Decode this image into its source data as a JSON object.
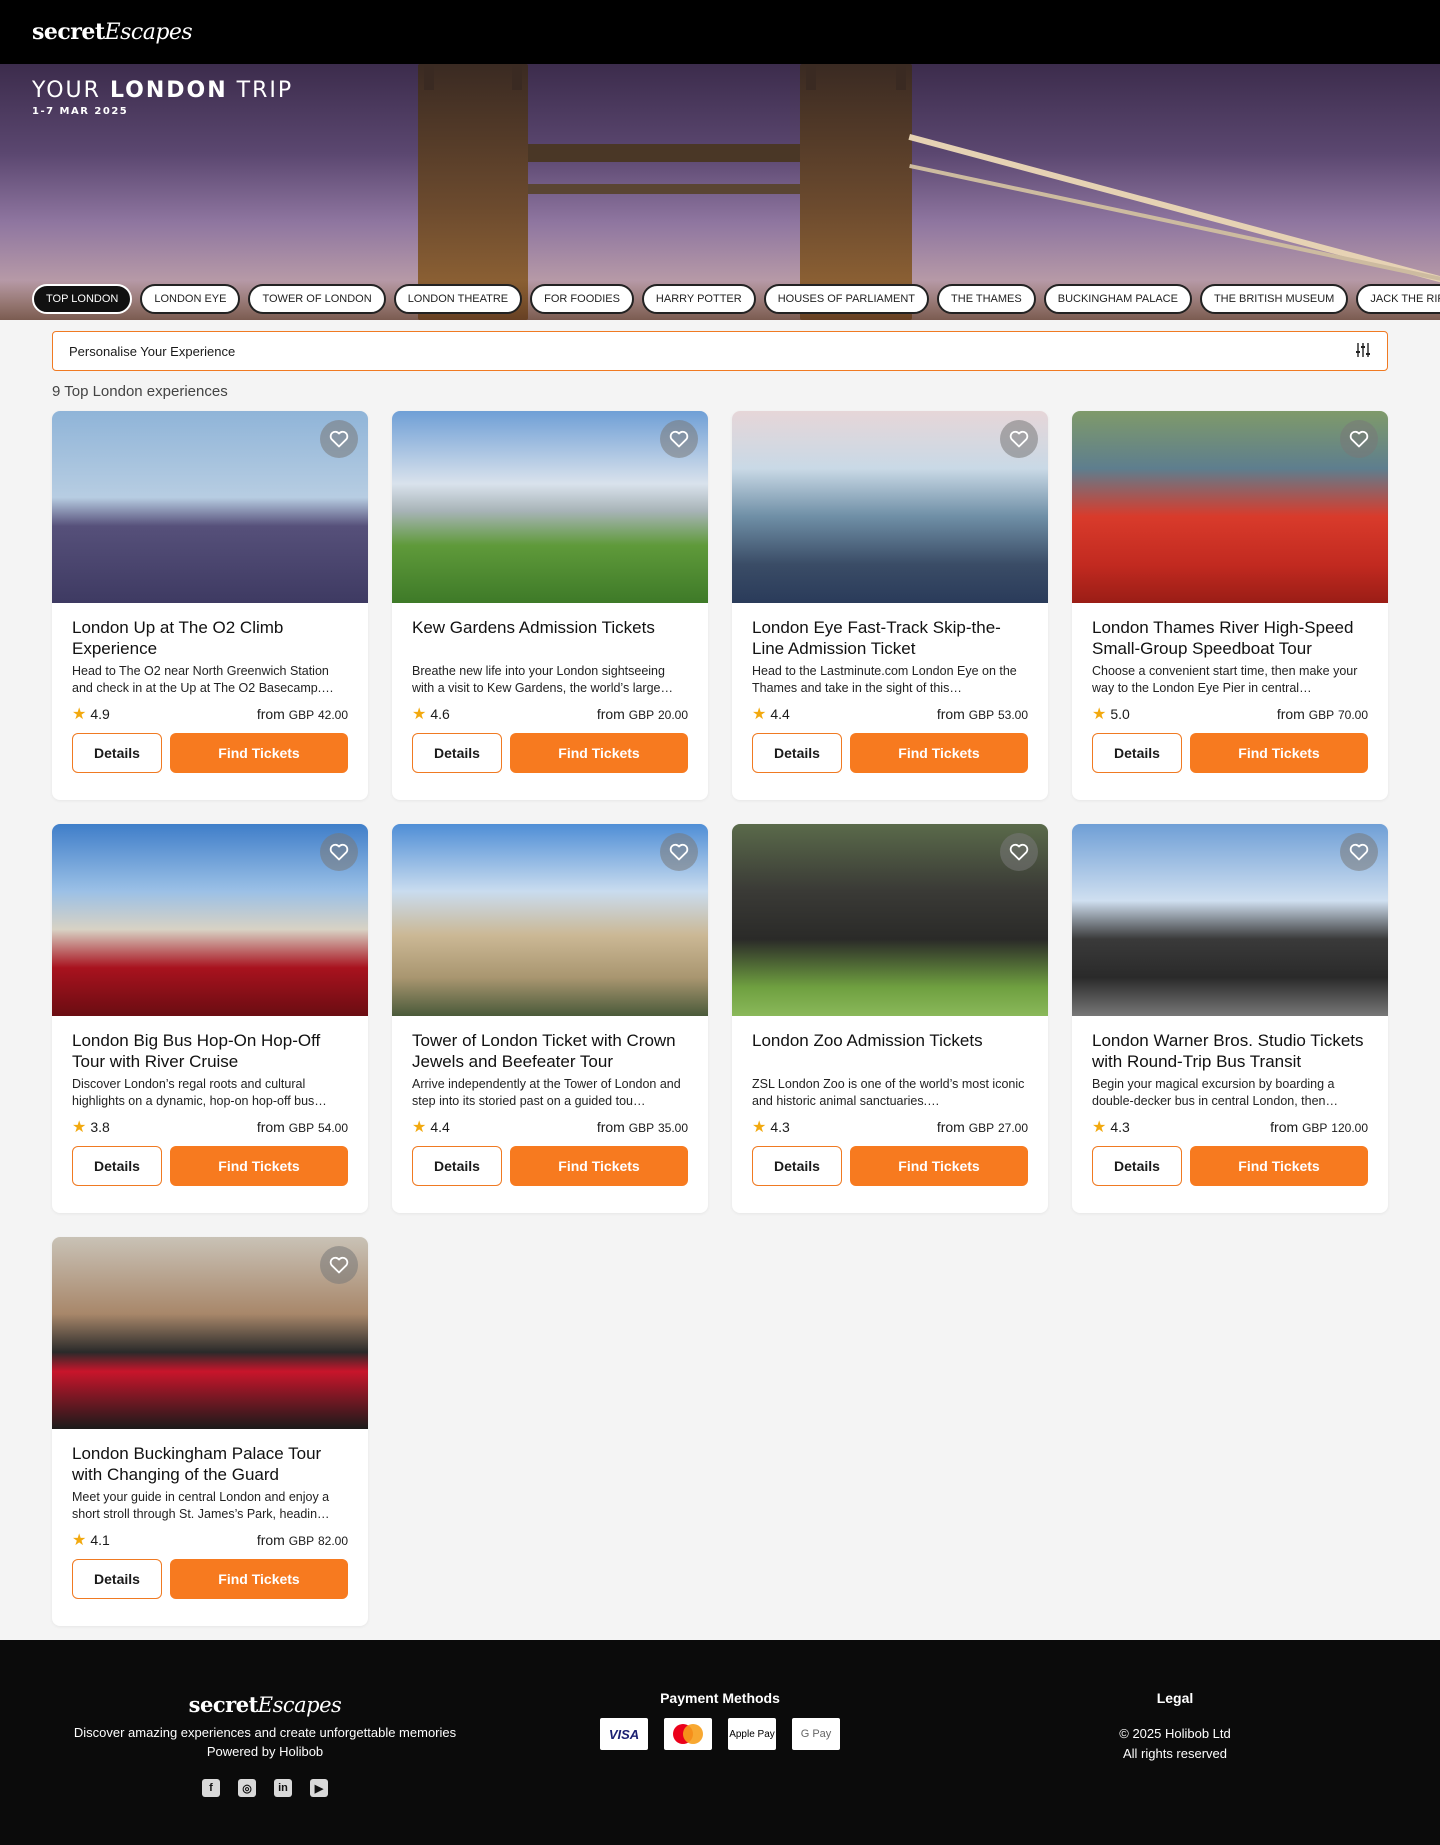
{
  "brand": {
    "logo_bold": "secret",
    "logo_italic": "Escapes"
  },
  "hero": {
    "title_prefix": "YOUR ",
    "title_city": "LONDON",
    "title_suffix": " TRIP",
    "dates": "1-7 MAR 2025"
  },
  "tabs": [
    {
      "label": "TOP LONDON",
      "active": true
    },
    {
      "label": "LONDON EYE"
    },
    {
      "label": "TOWER OF LONDON"
    },
    {
      "label": "LONDON THEATRE"
    },
    {
      "label": "FOR FOODIES"
    },
    {
      "label": "HARRY POTTER"
    },
    {
      "label": "HOUSES OF PARLIAMENT"
    },
    {
      "label": "THE THAMES"
    },
    {
      "label": "BUCKINGHAM PALACE"
    },
    {
      "label": "THE BRITISH MUSEUM"
    },
    {
      "label": "JACK THE RIPPER"
    }
  ],
  "personalise": {
    "label": "Personalise Your Experience",
    "icon": "sliders-icon"
  },
  "results": {
    "count_text": "9 Top London experiences"
  },
  "labels": {
    "details": "Details",
    "find_tickets": "Find Tickets",
    "from": "from",
    "currency": "GBP"
  },
  "accent_color": "#f77a1f",
  "cards": [
    {
      "title": "London Up at The O2 Climb Experience",
      "desc": "Head to The O2 near North Greenwich Station and check in at the Up at The O2 Basecamp.…",
      "rating": "4.9",
      "price": "42.00"
    },
    {
      "title": "Kew Gardens Admission Tickets",
      "desc": "Breathe new life into your London sightseeing with a visit to Kew Gardens, the world’s large…",
      "rating": "4.6",
      "price": "20.00"
    },
    {
      "title": "London Eye Fast-Track Skip-the-Line Admission Ticket",
      "desc": "Head to the Lastminute.com London Eye on the Thames and take in the sight of this…",
      "rating": "4.4",
      "price": "53.00"
    },
    {
      "title": "London Thames River High-Speed Small-Group Speedboat Tour",
      "desc": "Choose a convenient start time, then make your way to the London Eye Pier in central…",
      "rating": "5.0",
      "price": "70.00"
    },
    {
      "title": "London Big Bus Hop-On Hop-Off Tour with River Cruise",
      "desc": "Discover London’s regal roots and cultural highlights on a dynamic, hop-on hop-off bus…",
      "rating": "3.8",
      "price": "54.00"
    },
    {
      "title": "Tower of London Ticket with Crown Jewels and Beefeater Tour",
      "desc": "Arrive independently at the Tower of London and step into its storied past on a guided tou…",
      "rating": "4.4",
      "price": "35.00"
    },
    {
      "title": "London Zoo Admission Tickets",
      "desc": "ZSL London Zoo is one of the world’s most iconic and historic animal sanctuaries.…",
      "rating": "4.3",
      "price": "27.00"
    },
    {
      "title": "London Warner Bros. Studio Tickets with Round-Trip Bus Transit",
      "desc": "Begin your magical excursion by boarding a double-decker bus in central London, then…",
      "rating": "4.3",
      "price": "120.00"
    },
    {
      "title": "London Buckingham Palace Tour with Changing of the Guard",
      "desc": "Meet your guide in central London and enjoy a short stroll through St. James’s Park, headin…",
      "rating": "4.1",
      "price": "82.00"
    }
  ],
  "footer": {
    "tagline": "Discover amazing experiences and create unforgettable memories",
    "powered": "Powered by Holibob",
    "payment_heading": "Payment Methods",
    "payments": [
      "VISA",
      "Mastercard",
      "Apple Pay",
      "G Pay"
    ],
    "legal_heading": "Legal",
    "copyright": "© 2025 Holibob Ltd",
    "rights": "All rights reserved",
    "socials": [
      "facebook-icon",
      "instagram-icon",
      "linkedin-icon",
      "youtube-icon"
    ]
  }
}
